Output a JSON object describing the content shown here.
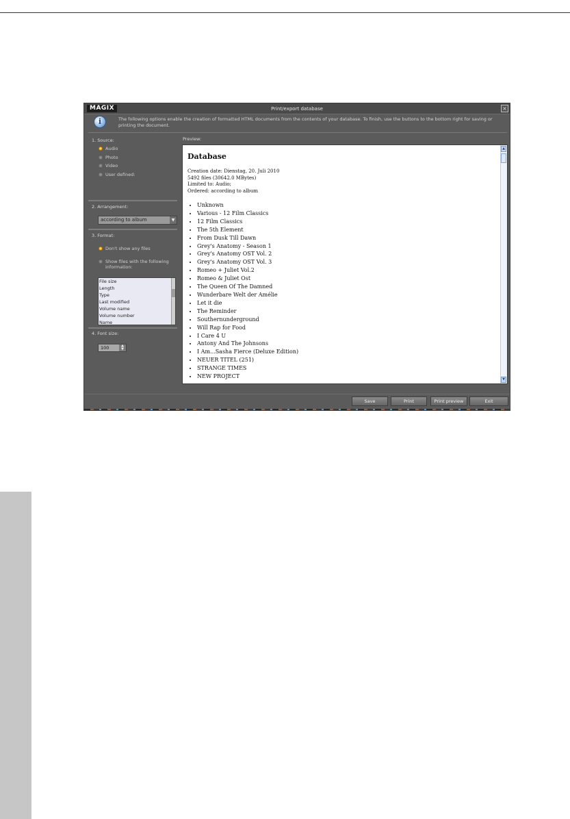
{
  "dialog": {
    "logo": "MAGIX",
    "title": "Print/export database",
    "close_symbol": "×",
    "info_icon": "info-icon",
    "info_text": "The following options enable the creation of formatted HTML documents from the contents of your database. To finish, use the buttons to the bottom right for saving or printing the document."
  },
  "source": {
    "label": "1. Source:",
    "options": [
      "Audio",
      "Photo",
      "Video",
      "User defined:"
    ],
    "selected": "Audio"
  },
  "arrangement": {
    "label": "2. Arrangement:",
    "value": "according to album"
  },
  "format": {
    "label": "3. Format:",
    "option_none": "Don't show any files",
    "option_show": "Show files with the following information:",
    "selected": "Don't show any files",
    "fields": [
      "File size",
      "Length",
      "Type",
      "Last modified",
      "Volume name",
      "Volume number",
      "Name"
    ]
  },
  "font_size": {
    "label": "4. Font size:",
    "value": "100"
  },
  "preview": {
    "label": "Preview:",
    "heading": "Database",
    "meta": [
      "Creation date: Dienstag, 20. Juli 2010",
      "5492 files (30642.0 MBytes)",
      "Limited to: Audio;",
      "Ordered: according to album"
    ],
    "items": [
      "Unknown",
      "Various - 12 Film Classics",
      "12 Film Classics",
      "The 5th Element",
      "From Dusk Till Dawn",
      "Grey's Anatomy - Season 1",
      "Grey's Anatomy OST Vol. 2",
      "Grey's Anatomy OST Vol. 3",
      "Romeo + Juliet Vol.2",
      "Romeo & Juliet Ost",
      "The Queen Of The Damned",
      "Wunderbare Welt der Amélie",
      "Let it die",
      "The Reminder",
      "Southernunderground",
      "Will Rap for Food",
      "I Care 4 U",
      "Antony And The Johnsons",
      "I Am...Sasha Fierce (Deluxe Edition)",
      "NEUER TITEL (251)",
      "STRANGE TIMES",
      "NEW PROJECT"
    ]
  },
  "buttons": {
    "save": "Save",
    "print": "Print",
    "print_preview": "Print preview",
    "exit": "Exit"
  }
}
